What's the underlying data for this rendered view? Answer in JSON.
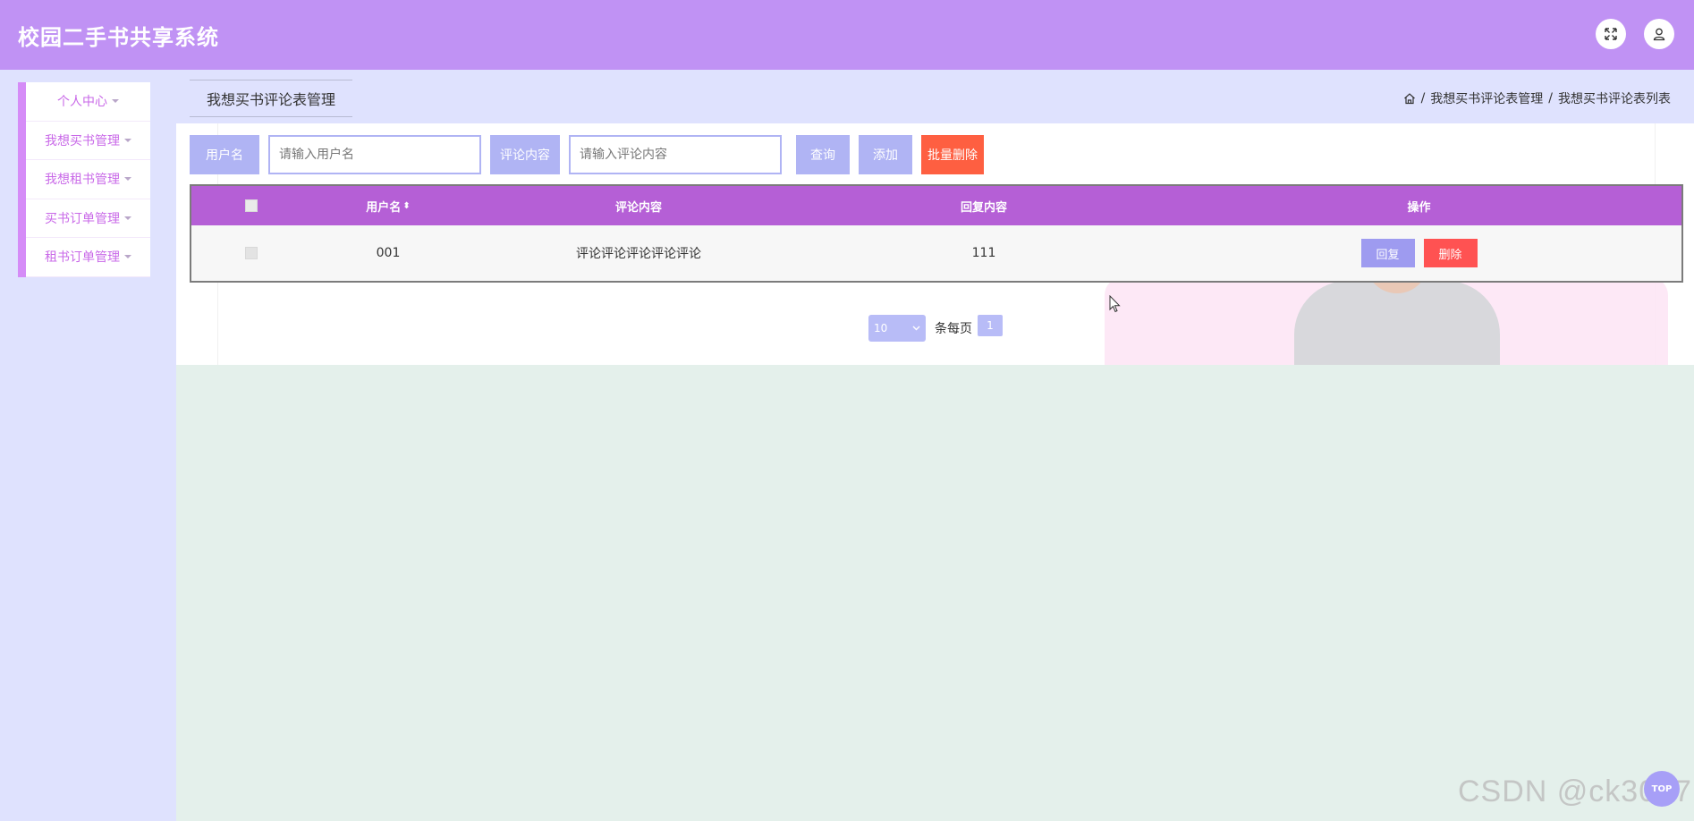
{
  "app": {
    "title": "校园二手书共享系统"
  },
  "header_icons": {
    "fullscreen": "fullscreen-icon",
    "user": "user-icon"
  },
  "sidebar": {
    "items": [
      {
        "label": "个人中心"
      },
      {
        "label": "我想买书管理"
      },
      {
        "label": "我想租书管理"
      },
      {
        "label": "买书订单管理"
      },
      {
        "label": "租书订单管理"
      }
    ]
  },
  "page_tab": {
    "label": "我想买书评论表管理"
  },
  "breadcrumb": {
    "icon": "home-icon",
    "items": [
      "我想买书评论表管理",
      "我想买书评论表列表"
    ],
    "separator": "/"
  },
  "search": {
    "username_label": "用户名",
    "username_placeholder": "请输入用户名",
    "comment_label": "评论内容",
    "comment_placeholder": "请输入评论内容",
    "query_button": "查询",
    "add_button": "添加",
    "batch_delete_button": "批量删除"
  },
  "table": {
    "columns": [
      "用户名",
      "评论内容",
      "回复内容",
      "操作"
    ],
    "rows": [
      {
        "username": "001",
        "comment": "评论评论评论评论评论",
        "reply": "111",
        "reply_button": "回复",
        "delete_button": "删除"
      }
    ]
  },
  "pagination": {
    "page_size": "10",
    "per_page_text": "条每页",
    "current_page": "1"
  },
  "watermark": "CSDN @ck3017",
  "back_to_top": "TOP",
  "colors": {
    "header_bg": "#c092f4",
    "sidebar_bg": "#dfe2fe",
    "sidebar_accent": "#d58cf7",
    "table_header": "#b55fd6",
    "button_primary": "#b0b4f4",
    "button_danger": "#fe5f41"
  }
}
